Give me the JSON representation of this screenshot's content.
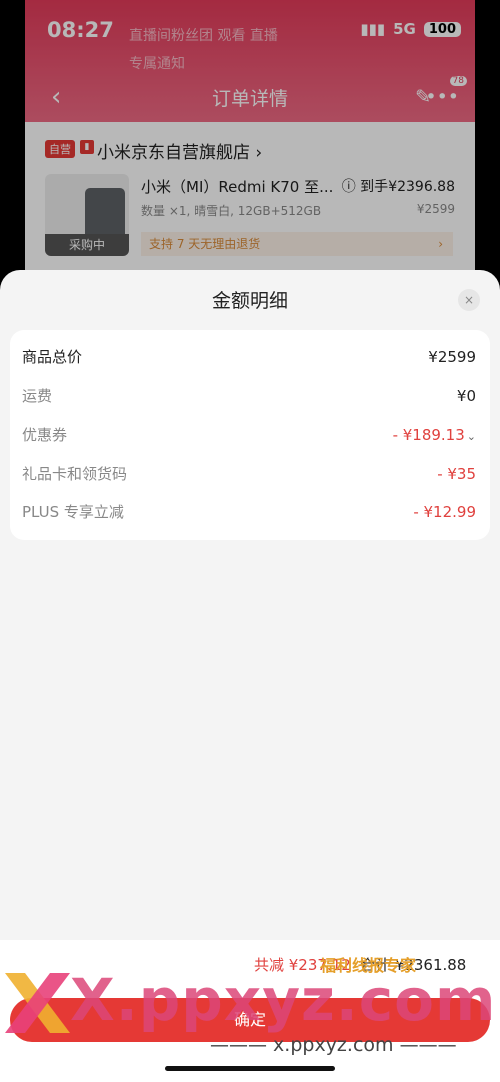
{
  "status_bar": {
    "time": "08:27",
    "network": "5G",
    "battery": "100"
  },
  "background_page": {
    "noise_text": [
      "直播间粉丝团 观看 直播",
      "专属通知"
    ],
    "nav": {
      "title": "订单详情",
      "badge": "78"
    },
    "store": {
      "tag": "自营",
      "name": "小米京东自营旗舰店 ›"
    },
    "product": {
      "title": "小米（MI）Redmi K70 至...",
      "price_prefix": "ⓘ 到手",
      "price": "¥2396.88",
      "spec": "数量 ×1, 晴雪白, 12GB+512GB",
      "orig_price": "¥2599",
      "image_overlay": "采购中",
      "return_policy": "支持 7 天无理由退货",
      "return_arrow": "›"
    }
  },
  "sheet": {
    "title": "金额明细",
    "close_icon": "×",
    "rows": [
      {
        "label": "商品总价",
        "value": "¥2599"
      },
      {
        "label": "运费",
        "value": "¥0"
      },
      {
        "label": "优惠券",
        "value": "- ¥189.13"
      },
      {
        "label": "礼品卡和领货码",
        "value": "- ¥35"
      },
      {
        "label": "PLUS 专享立减",
        "value": "- ¥12.99"
      }
    ],
    "coupon_chevron": "⌄"
  },
  "bottom": {
    "saved": "共减 ¥237.12",
    "total": "合计 ¥2361.88",
    "confirm": "确定"
  },
  "watermark": {
    "brand": "X.ppxyz.com",
    "subtitle": "福利线报专家",
    "url": "——— x.ppxyz.com ———"
  },
  "colors": {
    "accent": "#e53935",
    "discount": "#e0413e",
    "header": "#e33b5a"
  }
}
